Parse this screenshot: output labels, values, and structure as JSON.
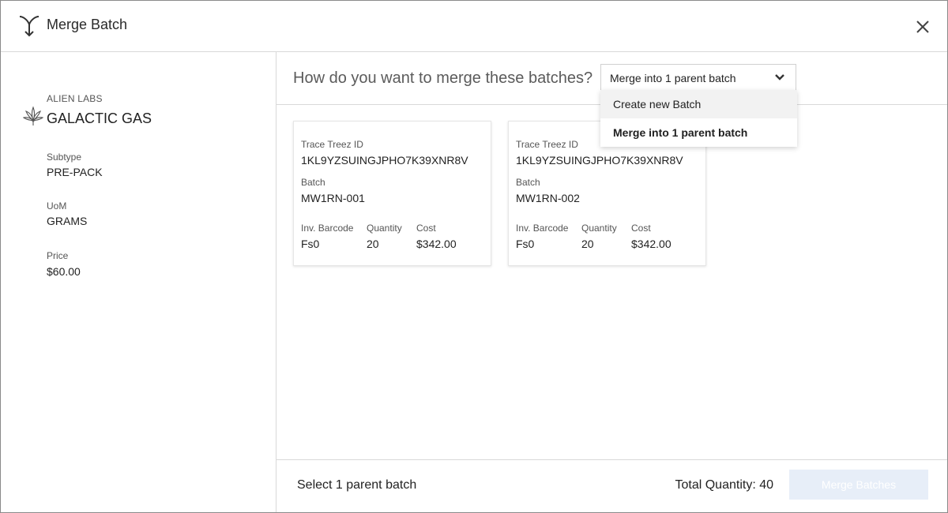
{
  "header": {
    "title": "Merge Batch",
    "icon": "merge-icon",
    "close_icon": "close-icon"
  },
  "product": {
    "brand": "ALIEN LABS",
    "name": "GALACTIC GAS",
    "icon": "cannabis-leaf-icon",
    "attributes": [
      {
        "label": "Subtype",
        "value": "PRE-PACK"
      },
      {
        "label": "UoM",
        "value": "GRAMS"
      },
      {
        "label": "Price",
        "value": "$60.00"
      }
    ]
  },
  "merge": {
    "question": "How do you want to merge these batches?",
    "select": {
      "value": "Merge into 1 parent batch",
      "options": [
        "Create new Batch",
        "Merge into 1 parent batch"
      ],
      "hovered_index": 0,
      "selected_index": 1
    }
  },
  "batches": [
    {
      "trace_label": "Trace Treez ID",
      "trace_id": "1KL9YZSUINGJPHO7K39XNR8V",
      "batch_label": "Batch",
      "batch": "MW1RN-001",
      "barcode_label": "Inv. Barcode",
      "barcode": "Fs0",
      "quantity_label": "Quantity",
      "quantity": "20",
      "cost_label": "Cost",
      "cost": "$342.00"
    },
    {
      "trace_label": "Trace Treez ID",
      "trace_id": "1KL9YZSUINGJPHO7K39XNR8V",
      "batch_label": "Batch",
      "batch": "MW1RN-002",
      "barcode_label": "Inv. Barcode",
      "barcode": "Fs0",
      "quantity_label": "Quantity",
      "quantity": "20",
      "cost_label": "Cost",
      "cost": "$342.00"
    }
  ],
  "footer": {
    "hint": "Select 1 parent batch",
    "total_quantity": "Total Quantity: 40",
    "merge_button": "Merge Batches",
    "merge_button_enabled": false
  },
  "colors": {
    "button_disabled_bg": "#e7eef8",
    "border": "#d9d9d9",
    "text": "#222222"
  }
}
